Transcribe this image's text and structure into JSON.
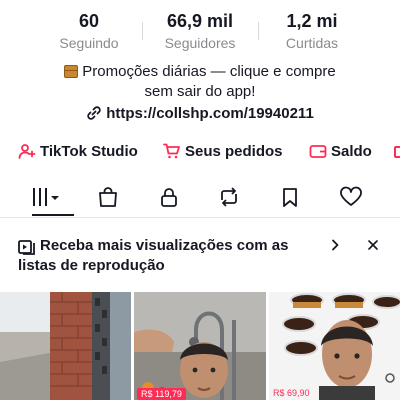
{
  "stats": [
    {
      "value": "60",
      "label": "Seguindo"
    },
    {
      "value": "66,9 mil",
      "label": "Seguidores"
    },
    {
      "value": "1,2 mi",
      "label": "Curtidas"
    }
  ],
  "bio": {
    "line1": "Promoções diárias — clique e compre",
    "line2": "sem sair do app!",
    "link": "https://collshp.com/19940211"
  },
  "shortcuts": {
    "studio": "TikTok Studio",
    "orders": "Seus pedidos",
    "balance": "Saldo"
  },
  "banner": {
    "text": "Receba mais visualizações com as listas de reprodução"
  },
  "thumbnails": {
    "t2_price": "R$ 119,79",
    "t3_price": "R$ 69,90"
  },
  "colors": {
    "accent": "#fe2c55",
    "text": "#161823",
    "muted": "#8a8b91"
  }
}
